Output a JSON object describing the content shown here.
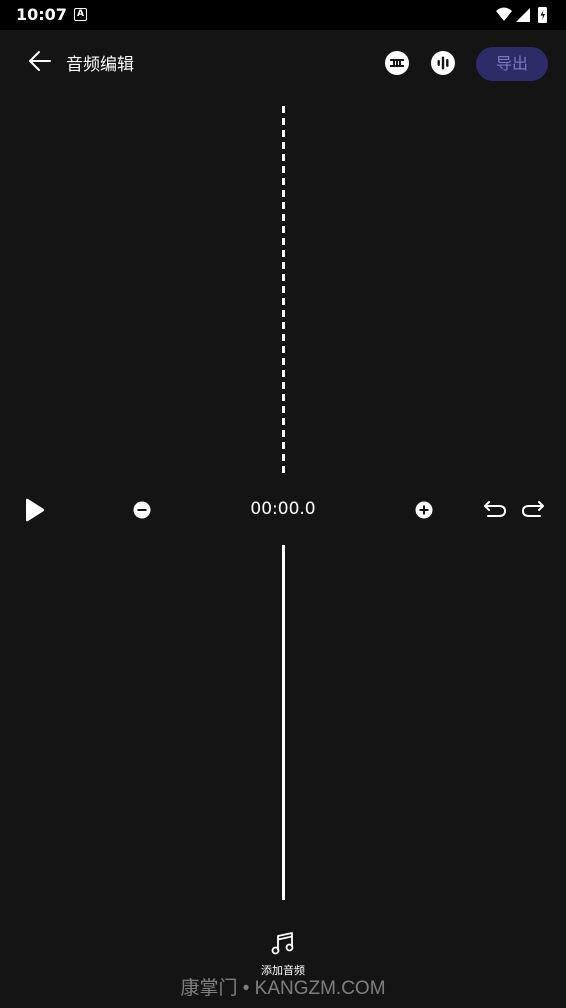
{
  "status": {
    "time": "10:07",
    "notification_badge": "A"
  },
  "header": {
    "title": "音频编辑",
    "export_label": "导出"
  },
  "controls": {
    "time": "00:00.0"
  },
  "footer": {
    "add_audio_label": "添加音频"
  },
  "watermark": {
    "text": "康掌门 • KANGZM.COM"
  },
  "colors": {
    "background": "#141414",
    "export_bg": "#2d2b66",
    "export_text": "#7c78c4"
  },
  "icons": [
    "back-arrow-icon",
    "subtitle-icon",
    "audio-wave-icon",
    "play-icon",
    "zoom-out-icon",
    "zoom-in-icon",
    "undo-icon",
    "redo-icon",
    "music-note-icon"
  ]
}
